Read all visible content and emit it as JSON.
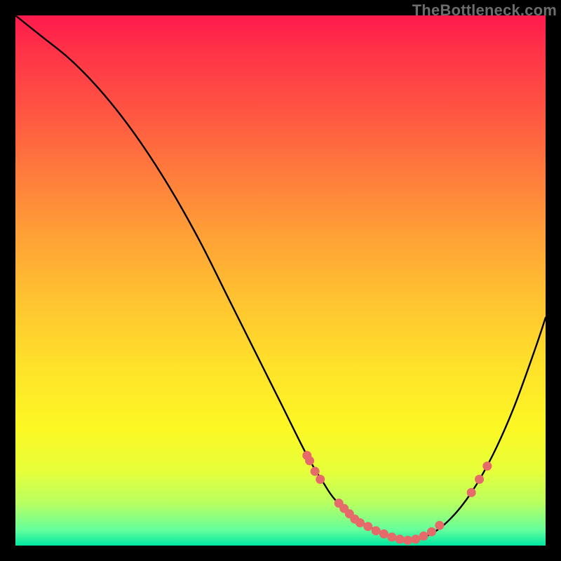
{
  "watermark": "TheBottleneck.com",
  "chart_data": {
    "type": "line",
    "title": "",
    "xlabel": "",
    "ylabel": "",
    "xlim": [
      0,
      100
    ],
    "ylim": [
      0,
      100
    ],
    "series": [
      {
        "name": "curve",
        "x": [
          0,
          5,
          10,
          15,
          20,
          25,
          30,
          35,
          40,
          45,
          50,
          55,
          58,
          60,
          63,
          66,
          70,
          74,
          78,
          82,
          86,
          90,
          94,
          98,
          100
        ],
        "y": [
          100,
          96,
          92,
          87,
          81,
          74,
          66,
          57,
          47,
          37,
          27,
          17,
          12,
          9,
          6,
          4,
          2,
          1,
          2,
          5,
          10,
          17,
          26,
          37,
          43
        ]
      }
    ],
    "markers": [
      {
        "x": 55.0,
        "y": 17.0
      },
      {
        "x": 55.5,
        "y": 16.0
      },
      {
        "x": 56.5,
        "y": 14.0
      },
      {
        "x": 57.5,
        "y": 12.5
      },
      {
        "x": 61.0,
        "y": 8.0
      },
      {
        "x": 62.0,
        "y": 7.0
      },
      {
        "x": 63.0,
        "y": 6.0
      },
      {
        "x": 64.0,
        "y": 5.0
      },
      {
        "x": 65.0,
        "y": 4.3
      },
      {
        "x": 66.5,
        "y": 3.6
      },
      {
        "x": 68.0,
        "y": 2.8
      },
      {
        "x": 69.5,
        "y": 2.2
      },
      {
        "x": 71.0,
        "y": 1.6
      },
      {
        "x": 72.5,
        "y": 1.2
      },
      {
        "x": 74.0,
        "y": 1.0
      },
      {
        "x": 75.5,
        "y": 1.2
      },
      {
        "x": 77.0,
        "y": 1.8
      },
      {
        "x": 78.5,
        "y": 2.6
      },
      {
        "x": 80.0,
        "y": 3.8
      },
      {
        "x": 86.0,
        "y": 10.0
      },
      {
        "x": 87.5,
        "y": 12.5
      },
      {
        "x": 89.0,
        "y": 15.0
      }
    ],
    "marker_color": "#e66a6a",
    "marker_radius": 6.5
  }
}
